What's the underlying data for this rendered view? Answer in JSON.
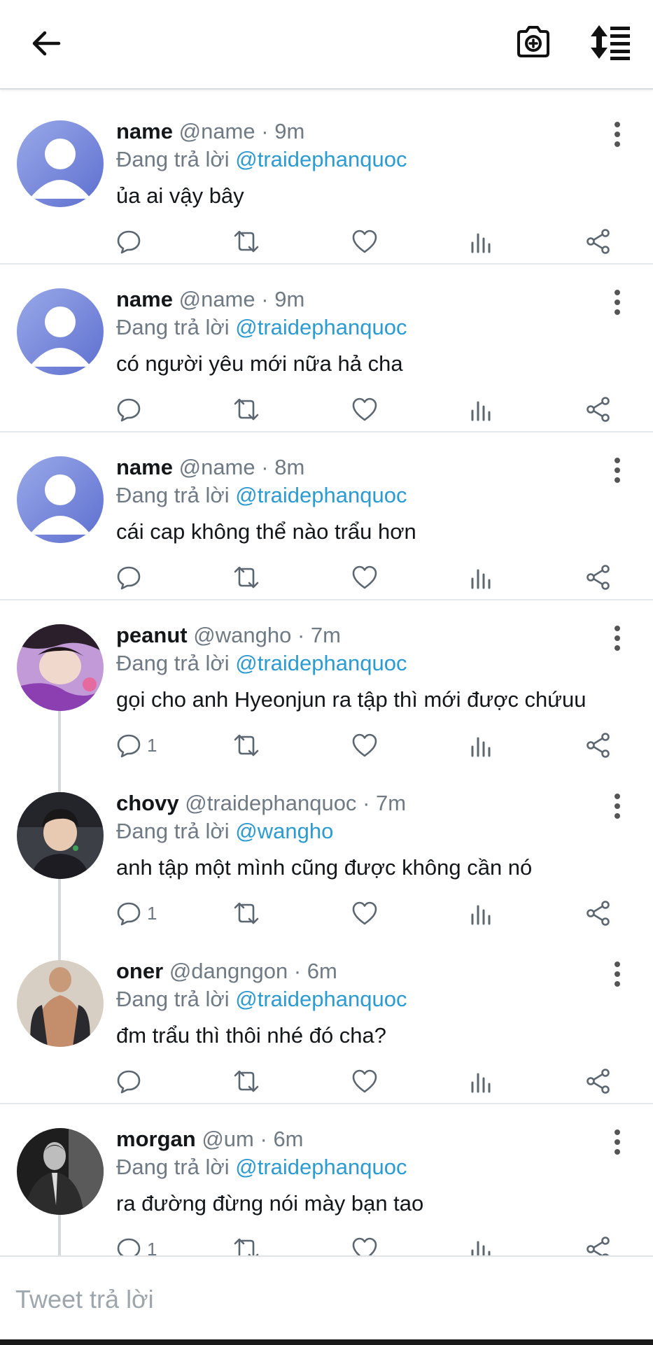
{
  "composer": {
    "placeholder": "Tweet trả lời"
  },
  "icons": {
    "back": "arrow-left-icon",
    "camera": "camera-add-icon",
    "sort": "sort-list-icon"
  },
  "colors": {
    "mention": "#2b9bd4",
    "secondary": "#6f7a84",
    "text": "#14171a"
  },
  "tweets": [
    {
      "name": "name",
      "handle": "@name",
      "dot": "·",
      "time": "9m",
      "replying_prefix": "Đang trả lời",
      "replying_to": "@traidephanquoc",
      "text": "ủa ai vậy bây",
      "reply_count": "",
      "avatar": "default",
      "thread": false
    },
    {
      "name": "name",
      "handle": "@name",
      "dot": "·",
      "time": "9m",
      "replying_prefix": "Đang trả lời",
      "replying_to": "@traidephanquoc",
      "text": "có người yêu mới nữa hả cha",
      "reply_count": "",
      "avatar": "default",
      "thread": false
    },
    {
      "name": "name",
      "handle": "@name",
      "dot": "·",
      "time": "8m",
      "replying_prefix": "Đang trả lời",
      "replying_to": "@traidephanquoc",
      "text": "cái cap không thể nào trẩu hơn",
      "reply_count": "",
      "avatar": "default",
      "thread": false
    },
    {
      "name": "peanut",
      "handle": "@wangho",
      "dot": "·",
      "time": "7m",
      "replying_prefix": "Đang trả lời",
      "replying_to": "@traidephanquoc",
      "text": "gọi cho anh Hyeonjun ra tập thì mới được chứuu",
      "reply_count": "1",
      "avatar": "photo-purple",
      "thread": true
    },
    {
      "name": "chovy",
      "handle": "@traidephanquoc",
      "dot": "·",
      "time": "7m",
      "replying_prefix": "Đang trả lời",
      "replying_to": "@wangho",
      "text": "anh tập một mình cũng được không cần nó",
      "reply_count": "1",
      "avatar": "photo-dark",
      "thread": true
    },
    {
      "name": "oner",
      "handle": "@dangngon",
      "dot": "·",
      "time": "6m",
      "replying_prefix": "Đang trả lời",
      "replying_to": "@traidephanquoc",
      "text": "đm trẩu thì thôi nhé đó cha?",
      "reply_count": "",
      "avatar": "photo-skin",
      "thread": false
    },
    {
      "name": "morgan",
      "handle": "@um",
      "dot": "·",
      "time": "6m",
      "replying_prefix": "Đang trả lời",
      "replying_to": "@traidephanquoc",
      "text": "ra đường đừng nói mày bạn tao",
      "reply_count": "1",
      "avatar": "photo-bw",
      "thread": true
    }
  ]
}
